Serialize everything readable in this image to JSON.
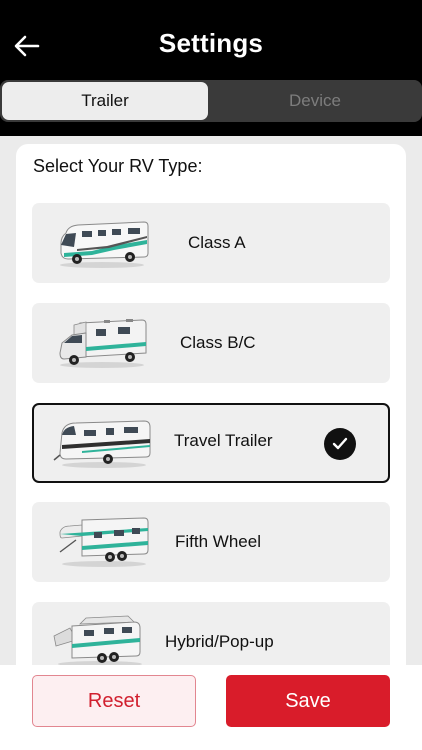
{
  "header": {
    "title": "Settings",
    "back_icon": "arrow-left-icon"
  },
  "tabs": [
    {
      "label": "Trailer",
      "active": true
    },
    {
      "label": "Device",
      "active": false
    }
  ],
  "rv_select": {
    "prompt": "Select Your RV Type:",
    "options": [
      {
        "label": "Class A",
        "selected": false,
        "icon": "class-a-motorhome-image"
      },
      {
        "label": "Class B/C",
        "selected": false,
        "icon": "class-bc-camper-image"
      },
      {
        "label": "Travel Trailer",
        "selected": true,
        "icon": "travel-trailer-image"
      },
      {
        "label": "Fifth Wheel",
        "selected": false,
        "icon": "fifth-wheel-image"
      },
      {
        "label": "Hybrid/Pop-up",
        "selected": false,
        "icon": "hybrid-popup-image"
      }
    ]
  },
  "footer": {
    "reset_label": "Reset",
    "save_label": "Save"
  },
  "colors": {
    "accent": "#d91c2a",
    "header_bg": "#000000",
    "rv_stripe": "#2fb39a"
  }
}
